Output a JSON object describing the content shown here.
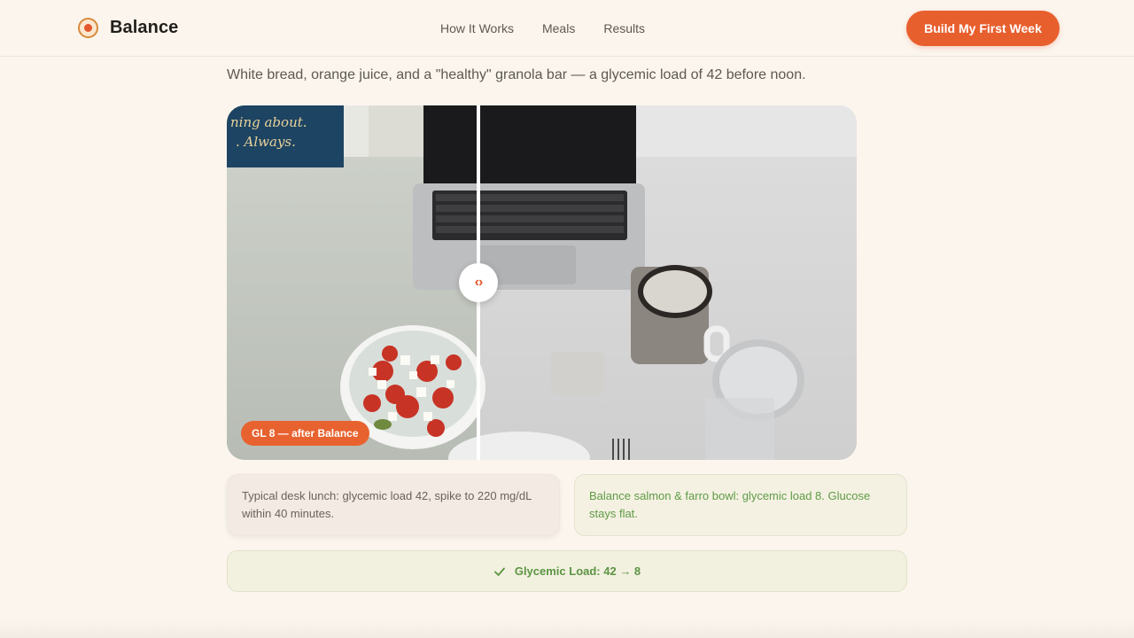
{
  "header": {
    "brand": "Balance",
    "nav": [
      "How It Works",
      "Meals",
      "Results"
    ],
    "cta": "Build My First Week"
  },
  "intro": "White bread, orange juice, and a \"healthy\" granola bar — a glycemic load of 42 before noon.",
  "compare": {
    "handle_icon": "‹›",
    "badge": "GL 8 — after Balance",
    "sign_text_1": "ning about.",
    "sign_text_2": ". Always."
  },
  "cards": {
    "before": "Typical desk lunch: glycemic load 42, spike to 220 mg/dL within 40 minutes.",
    "after": "Balance salmon & farro bowl: glycemic load 8. Glucose stays flat."
  },
  "result": "Glycemic Load: 42 → 8",
  "colors": {
    "accent": "#e85f2e",
    "success": "#5c9442",
    "background": "#fbf5ee"
  }
}
